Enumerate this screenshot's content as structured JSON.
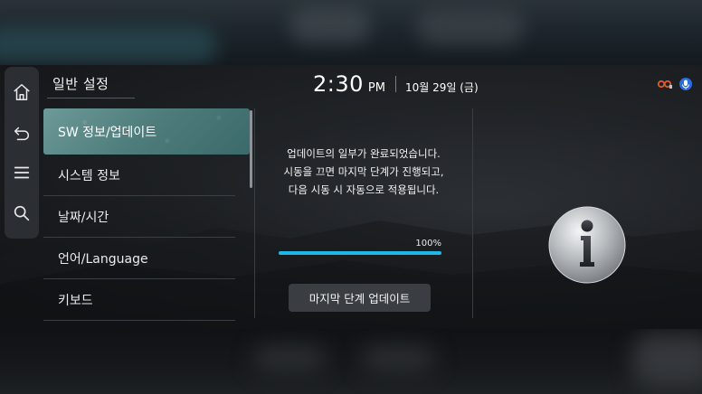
{
  "header": {
    "section_title": "일반 설정",
    "time": "2:30",
    "ampm": "PM",
    "date": "10월 29일 (금)"
  },
  "rail": {
    "items": [
      {
        "icon": "home-icon"
      },
      {
        "icon": "back-icon"
      },
      {
        "icon": "menu-icon"
      },
      {
        "icon": "search-icon"
      }
    ]
  },
  "menu": {
    "items": [
      {
        "label": "SW 정보/업데이트",
        "active": true
      },
      {
        "label": "시스템 정보"
      },
      {
        "label": "날짜/시간"
      },
      {
        "label": "언어/Language"
      },
      {
        "label": "키보드"
      }
    ]
  },
  "update": {
    "message_line1": "업데이트의 일부가 완료되었습니다.",
    "message_line2": "시동을 끄면 마지막 단계가 진행되고,",
    "message_line3": "다음 시동 시 자동으로 적용됩니다.",
    "progress_label": "100%",
    "progress": 1.0,
    "button_label": "마지막 단계 업데이트"
  },
  "colors": {
    "accent": "#1fb8e6",
    "active_item": "#5a8a89",
    "status_connected": "#e05a2a",
    "status_mic": "#2a6be0"
  }
}
